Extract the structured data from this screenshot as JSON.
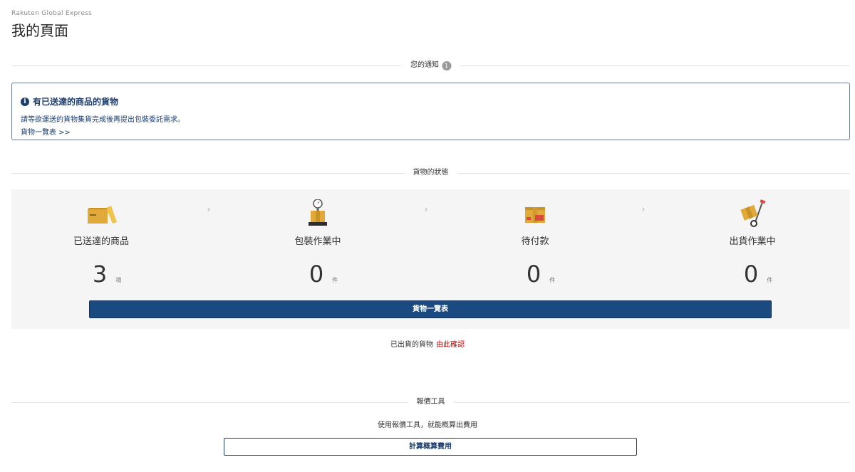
{
  "header": {
    "brand": "Rakuten Global Express",
    "title": "我的頁面"
  },
  "notifications": {
    "section_label": "您的通知",
    "badge_count": "1",
    "notice": {
      "title": "有已送達的商品的貨物",
      "body": "請等欲運送的貨物集貨完成後再提出包裝委託需求。",
      "link": "貨物一覽表 >>"
    }
  },
  "status": {
    "section_label": "貨物的狀態",
    "items": [
      {
        "label": "已送達的商品",
        "count": "3",
        "unit": "項",
        "icon": "open-box-icon"
      },
      {
        "label": "包裝作業中",
        "count": "0",
        "unit": "件",
        "icon": "scale-box-icon"
      },
      {
        "label": "待付款",
        "count": "0",
        "unit": "件",
        "icon": "taped-box-icon"
      },
      {
        "label": "出貨作業中",
        "count": "0",
        "unit": "件",
        "icon": "hand-truck-icon"
      }
    ],
    "list_button": "貨物一覽表"
  },
  "shipped": {
    "text": "已出貨的貨物",
    "link": "由此確認"
  },
  "quote": {
    "section_label": "報價工具",
    "description": "使用報價工具，就能概算出費用",
    "button": "計算概算費用"
  },
  "colors": {
    "navy": "#1b4a80",
    "link_red": "#cc0000",
    "box_gold": "#e0a93a"
  }
}
